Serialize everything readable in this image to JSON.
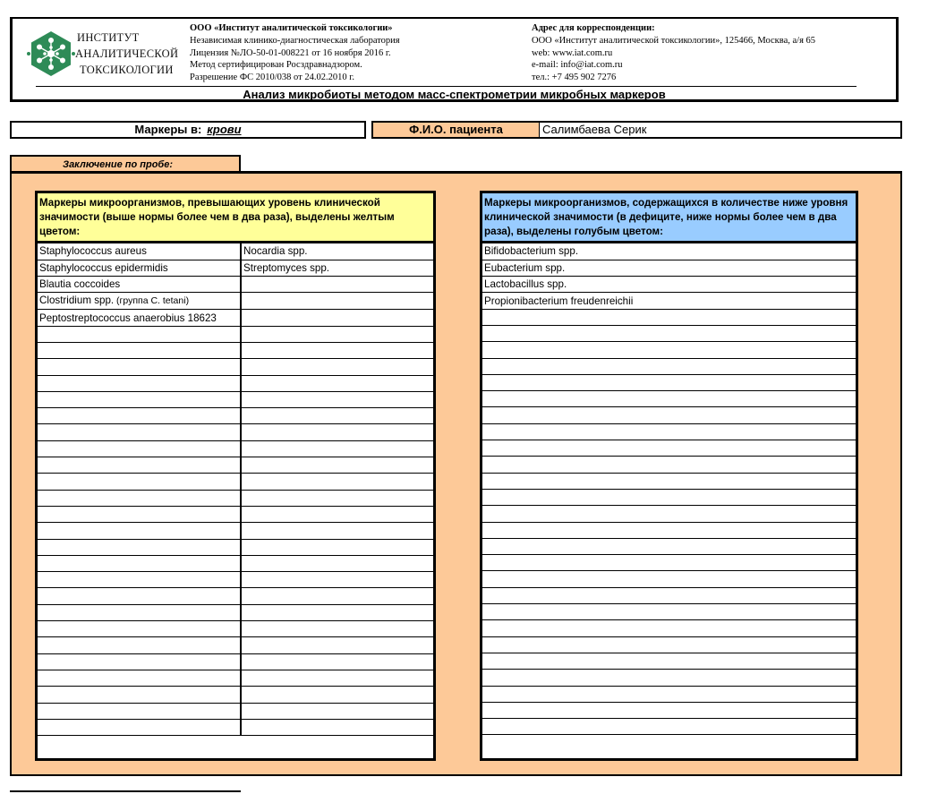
{
  "header": {
    "logo_lines": [
      "ИНСТИТУТ",
      "АНАЛИТИЧЕСКОЙ",
      "ТОКСИКОЛОГИИ"
    ],
    "org_lines": [
      "ООО «Институт аналитической токсикологии»",
      "Независимая клинико-диагностическая лаборатория",
      "Лицензия №ЛО-50-01-008221 от 16 ноября 2016 г.",
      "Метод сертифицирован Росздравнадзором.",
      "Разрешение ФС 2010/038 от 24.02.2010 г."
    ],
    "addr_lines": [
      "Адрес для корреспонденции:",
      "ООО «Институт аналитической токсикологии», 125466, Москва, а/я 65",
      "web: www.iat.com.ru",
      "e-mail: info@iat.com.ru",
      "тел.: +7 495 902 7276"
    ],
    "title": "Анализ микробиоты методом масс-спектрометрии микробных маркеров",
    "logo_color": "#2e8b57"
  },
  "markers": {
    "label": "Маркеры в:",
    "value": "крови"
  },
  "patient": {
    "label": "Ф.И.О. пациента",
    "value": "Салимбаева Серик"
  },
  "conclusion": {
    "label": "Заключение по пробе:",
    "excess": {
      "header": "Маркеры микроорганизмов, превышающих уровень клинической значимости (выше нормы более чем в два раза), выделены желтым цветом:",
      "col1": [
        "Staphylococcus aureus",
        "Staphylococcus epidermidis",
        "Blautia coccoides",
        "Clostridium spp.",
        "Peptostreptococcus anaerobius 18623"
      ],
      "col1_note": " (группа C. tetani)",
      "col2": [
        "Nocardia  spp.",
        "Streptomyces  spp."
      ]
    },
    "deficit": {
      "header": "Маркеры микроорганизмов, содержащихся в количестве ниже уровня клинической значимости (в дефиците, ниже нормы более чем в два раза), выделены голубым цветом:",
      "items": [
        "Bifidobacterium spp.",
        "Eubacterium spp.",
        "Lactobacillus spp.",
        "Propionibacterium freudenreichii"
      ]
    },
    "rows": 30
  },
  "colors": {
    "accent": "#fdc998",
    "yellow": "#ffff99",
    "blue": "#99ccff"
  }
}
